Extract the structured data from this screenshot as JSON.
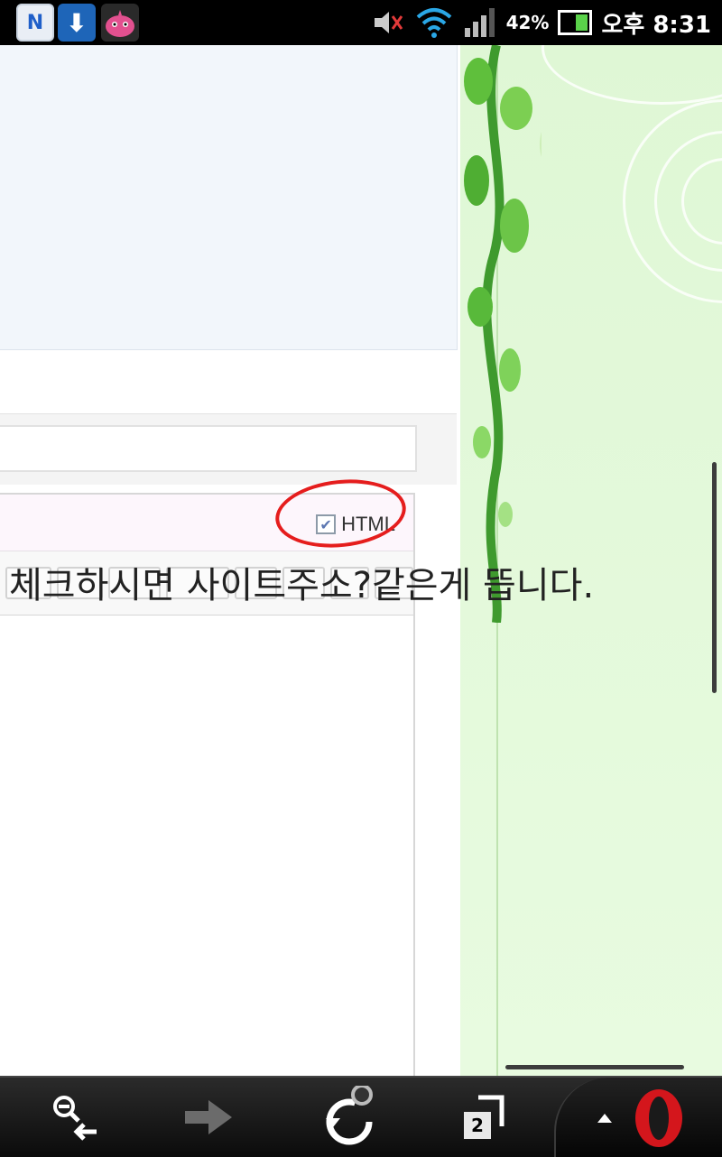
{
  "status_bar": {
    "notif_n": "N",
    "battery_percent": "42%",
    "time": "오후 8:31"
  },
  "editor": {
    "html_checkbox_label": "HTML",
    "html_checked": true
  },
  "annotation": {
    "text": "체크하시면 사이트주소?같은게 뜹니다."
  },
  "navbar": {
    "tab_count": "2"
  },
  "colors": {
    "annotation_red": "#e51d1d",
    "green_bg": "#e8fbe0"
  }
}
